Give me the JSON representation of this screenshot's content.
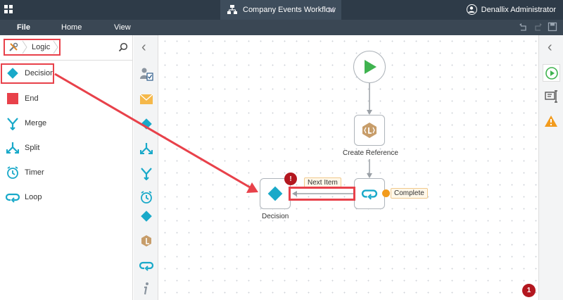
{
  "window": {
    "tab_title": "Company Events Workflow",
    "close_glyph": "✕",
    "user_name": "Denallix Administrator"
  },
  "menu": {
    "file": "File",
    "home": "Home",
    "view": "View"
  },
  "left_panel": {
    "breadcrumb": "Logic",
    "items": [
      {
        "label": "Decision",
        "icon": "decision-icon"
      },
      {
        "label": "End",
        "icon": "end-icon"
      },
      {
        "label": "Merge",
        "icon": "merge-icon"
      },
      {
        "label": "Split",
        "icon": "split-icon"
      },
      {
        "label": "Timer",
        "icon": "timer-icon"
      },
      {
        "label": "Loop",
        "icon": "loop-icon"
      }
    ],
    "collapse_glyph": "‹"
  },
  "canvas": {
    "nodes": {
      "create_reference": "Create Reference",
      "decision": "Decision"
    },
    "tags": {
      "next_item": "Next Item",
      "complete": "Complete"
    },
    "decision_warning": "!",
    "error_count": "1"
  },
  "right_panel": {
    "collapse_glyph": "‹"
  },
  "colors": {
    "titlebar": "#2e3b48",
    "accent_green": "#3fb34f",
    "accent_teal": "#19a9c9",
    "highlight_red": "#e8414a",
    "warning_orange": "#f29b1d",
    "error_red": "#b3171f"
  }
}
